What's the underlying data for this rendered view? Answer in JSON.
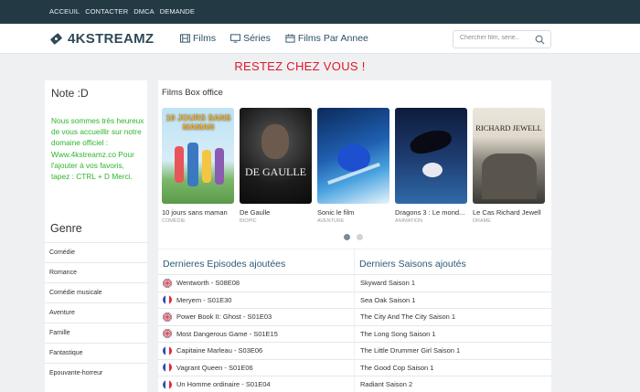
{
  "topbar": {
    "links": [
      "ACCEUIL",
      "CONTACTER",
      "DMCA",
      "DEMANDE"
    ]
  },
  "header": {
    "logo": "4KSTREAMZ",
    "nav": [
      {
        "label": "Films",
        "icon": "film-icon"
      },
      {
        "label": "Séries",
        "icon": "tv-icon"
      },
      {
        "label": "Films Par Annee",
        "icon": "calendar-icon"
      }
    ],
    "search_placeholder": "Chercher film, série.."
  },
  "alert": "RESTEZ CHEZ VOUS !",
  "note": {
    "title": "Note :D",
    "text": "Nous sommes très heureux de vous accueillir sur notre domaine officiel : Www.4kstreamz.co Pour l'ajouter à vos favoris, tapez : CTRL + D Merci."
  },
  "genre": {
    "title": "Genre",
    "items": [
      "Comédie",
      "Romance",
      "Comédie musicale",
      "Aventure",
      "Famille",
      "Fantastique",
      "Epouvante-horreur"
    ]
  },
  "box_office": {
    "title": "Films Box office",
    "movies": [
      {
        "title": "10 jours sans maman",
        "genre": "COMÉDIE",
        "poster_text": "10 JOURS SANS MAMAN"
      },
      {
        "title": "De Gaulle",
        "genre": "BIOPIC",
        "poster_text": "DE GAULLE"
      },
      {
        "title": "Sonic le film",
        "genre": "AVENTURE",
        "poster_text": ""
      },
      {
        "title": "Dragons 3 : Le mond...",
        "genre": "ANIMATION",
        "poster_text": ""
      },
      {
        "title": "Le Cas Richard Jewell",
        "genre": "DRAME",
        "poster_text": "RICHARD JEWELL"
      }
    ]
  },
  "episodes": {
    "title": "Dernieres Episodes ajoutées",
    "items": [
      {
        "text": "Wentworth - S08E08",
        "flag": "uk"
      },
      {
        "text": "Meryem - S01E30",
        "flag": "fr"
      },
      {
        "text": "Power Book II: Ghost - S01E03",
        "flag": "uk"
      },
      {
        "text": "Most Dangerous Game - S01E15",
        "flag": "uk"
      },
      {
        "text": "Capitaine Marleau - S03E06",
        "flag": "fr"
      },
      {
        "text": "Vagrant Queen - S01E06",
        "flag": "fr"
      },
      {
        "text": "Un Homme ordinaire - S01E04",
        "flag": "fr"
      }
    ]
  },
  "seasons": {
    "title": "Derniers Saisons ajoutés",
    "items": [
      "Skyward Saison 1",
      "Sea Oak Saison 1",
      "The City And The City Saison 1",
      "The Long Song Saison 1",
      "The Little Drummer Girl Saison 1",
      "The Good Cop Saison 1",
      "Radiant Saison 2"
    ]
  },
  "colors": {
    "topbar": "#233a45",
    "alert": "#e3162b",
    "note_text": "#2db52d",
    "section_title": "#2b5a78"
  }
}
